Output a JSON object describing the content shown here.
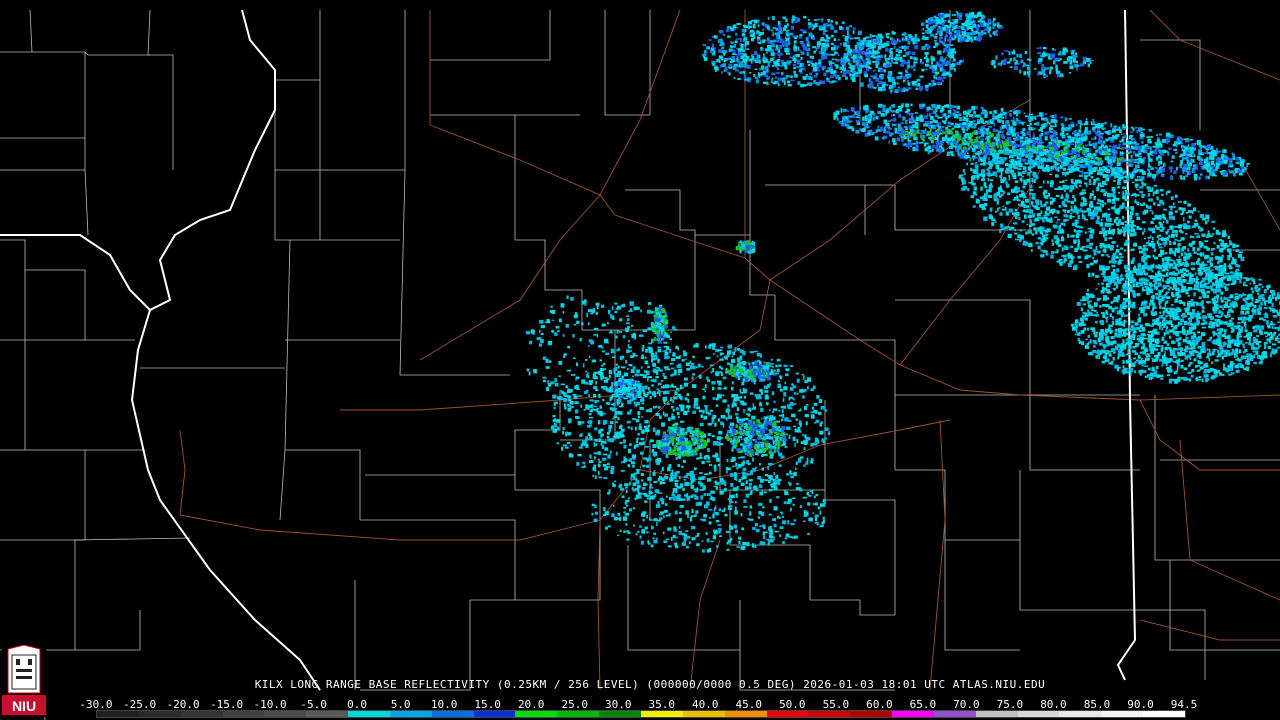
{
  "product_title": "KILX LONG RANGE BASE REFLECTIVITY (0.25KM / 256 LEVEL) (000000/0000 0.5 DEG) 2026-01-03 18:01 UTC  ATLAS.NIU.EDU",
  "logo_text": "NIU",
  "scale_labels": [
    "-30.0",
    "-25.0",
    "-20.0",
    "-15.0",
    "-10.0",
    "-5.0",
    "0.0",
    "5.0",
    "10.0",
    "15.0",
    "20.0",
    "25.0",
    "30.0",
    "35.0",
    "40.0",
    "45.0",
    "50.0",
    "55.0",
    "60.0",
    "65.0",
    "70.0",
    "75.0",
    "80.0",
    "85.0",
    "90.0",
    "94.5"
  ],
  "scale_colors": [
    "#202020",
    "#2a2a2a",
    "#343434",
    "#404040",
    "#4c4c4c",
    "#5a5a5a",
    "#00d8d8",
    "#00a8e8",
    "#0070e8",
    "#0030d8",
    "#00e000",
    "#00b800",
    "#008800",
    "#f0f000",
    "#e8c000",
    "#f09000",
    "#f00000",
    "#d00000",
    "#b00000",
    "#ff00ff",
    "#9050d0",
    "#c0c0c0",
    "#d8d8d8",
    "#e8e8e8",
    "#f4f4f4",
    "#ffffff"
  ],
  "colors": {
    "county_lines": "#cfcfcf",
    "state_lines": "#ffffff",
    "roads": "#a0522d",
    "echo_light": "#00d8e8",
    "echo_medium": "#2060e8",
    "echo_strong": "#20c020"
  }
}
